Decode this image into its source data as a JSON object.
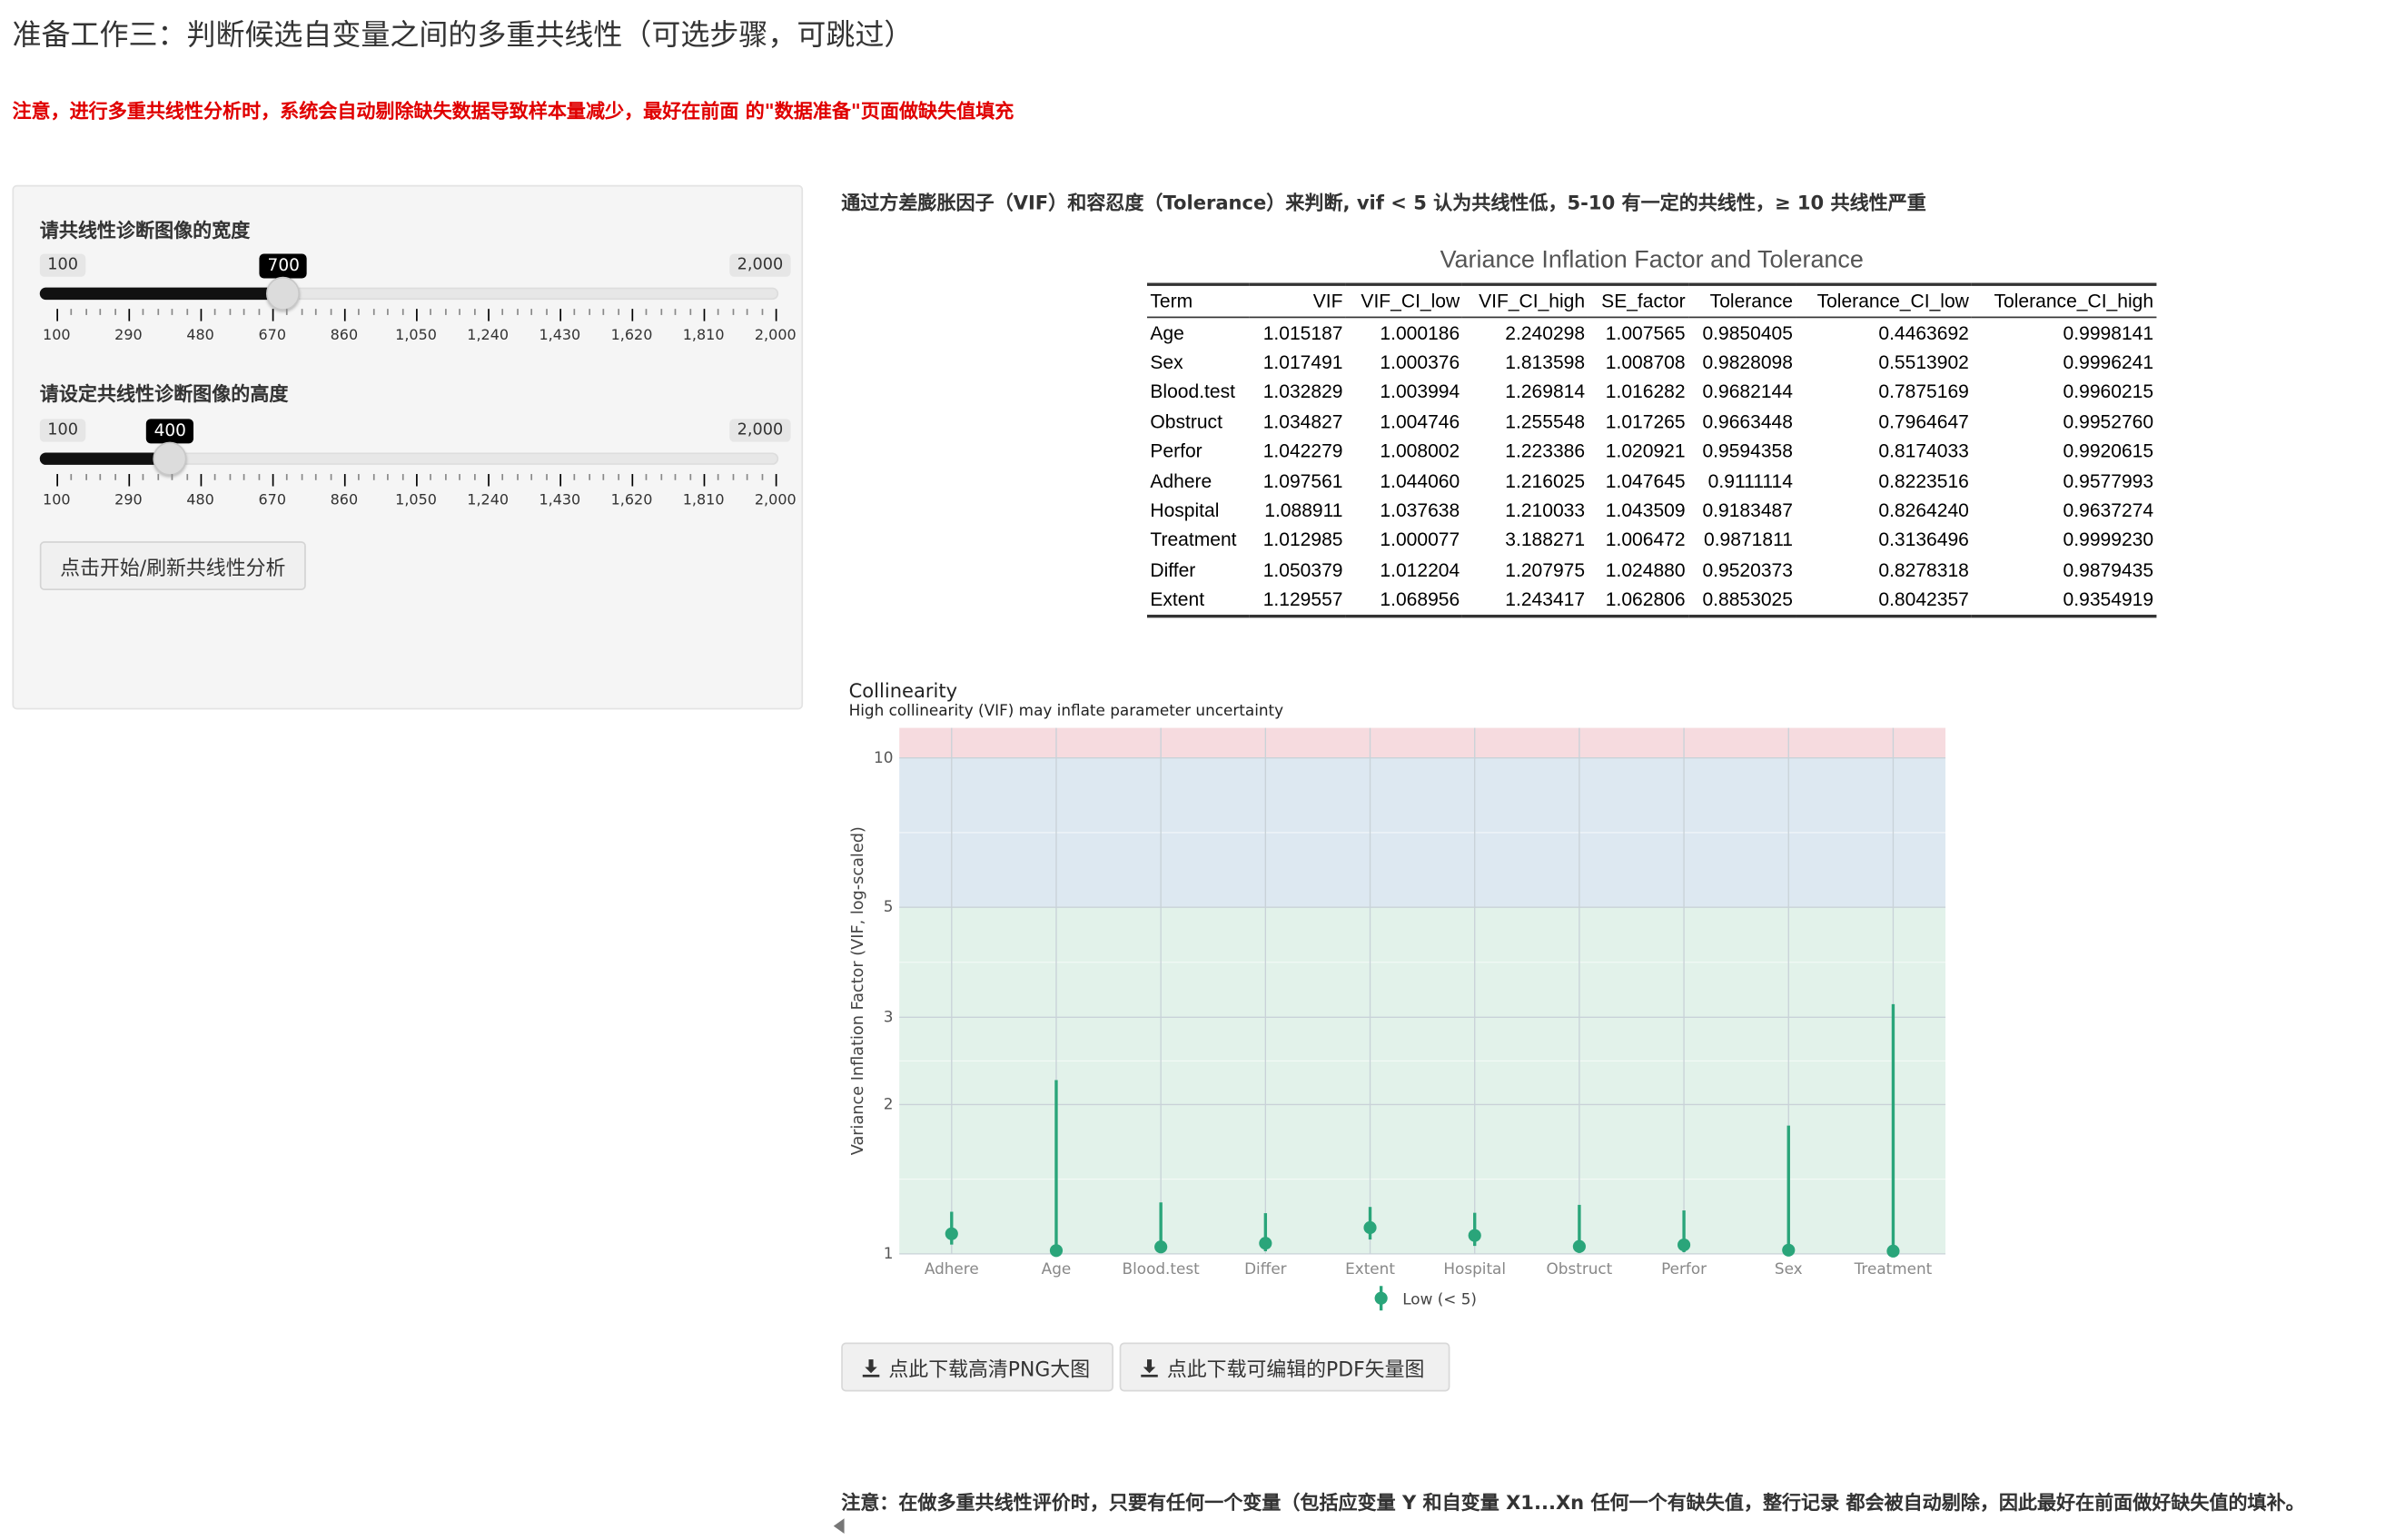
{
  "page": {
    "title": "准备工作三：判断候选自变量之间的多重共线性（可选步骤，可跳过）",
    "warning": "注意，进行多重共线性分析时，系统会自动剔除缺失数据导致样本量减少，最好在前面 的\"数据准备\"页面做缺失值填充"
  },
  "sidebar": {
    "width_slider": {
      "label": "请共线性诊断图像的宽度",
      "min_label": "100",
      "max_label": "2,000",
      "value_label": "700",
      "value": 700,
      "min": 100,
      "max": 2000,
      "tick_labels": [
        "100",
        "290",
        "480",
        "670",
        "860",
        "1,050",
        "1,240",
        "1,430",
        "1,620",
        "1,810",
        "2,000"
      ]
    },
    "height_slider": {
      "label": "请设定共线性诊断图像的高度",
      "min_label": "100",
      "max_label": "2,000",
      "value_label": "400",
      "value": 400,
      "min": 100,
      "max": 2000,
      "tick_labels": [
        "100",
        "290",
        "480",
        "670",
        "860",
        "1,050",
        "1,240",
        "1,430",
        "1,620",
        "1,810",
        "2,000"
      ]
    },
    "run_button": "点击开始/刷新共线性分析"
  },
  "main": {
    "description": "通过方差膨胀因子（VIF）和容忍度（Tolerance）来判断, vif < 5 认为共线性低，5-10 有一定的共线性，≥ 10 共线性严重",
    "table": {
      "title": "Variance Inflation Factor and Tolerance",
      "columns": [
        "Term",
        "VIF",
        "VIF_CI_low",
        "VIF_CI_high",
        "SE_factor",
        "Tolerance",
        "Tolerance_CI_low",
        "Tolerance_CI_high"
      ],
      "rows": [
        [
          "Age",
          "1.015187",
          "1.000186",
          "2.240298",
          "1.007565",
          "0.9850405",
          "0.4463692",
          "0.9998141"
        ],
        [
          "Sex",
          "1.017491",
          "1.000376",
          "1.813598",
          "1.008708",
          "0.9828098",
          "0.5513902",
          "0.9996241"
        ],
        [
          "Blood.test",
          "1.032829",
          "1.003994",
          "1.269814",
          "1.016282",
          "0.9682144",
          "0.7875169",
          "0.9960215"
        ],
        [
          "Obstruct",
          "1.034827",
          "1.004746",
          "1.255548",
          "1.017265",
          "0.9663448",
          "0.7964647",
          "0.9952760"
        ],
        [
          "Perfor",
          "1.042279",
          "1.008002",
          "1.223386",
          "1.020921",
          "0.9594358",
          "0.8174033",
          "0.9920615"
        ],
        [
          "Adhere",
          "1.097561",
          "1.044060",
          "1.216025",
          "1.047645",
          "0.9111114",
          "0.8223516",
          "0.9577993"
        ],
        [
          "Hospital",
          "1.088911",
          "1.037638",
          "1.210033",
          "1.043509",
          "0.9183487",
          "0.8264240",
          "0.9637274"
        ],
        [
          "Treatment",
          "1.012985",
          "1.000077",
          "3.188271",
          "1.006472",
          "0.9871811",
          "0.3136496",
          "0.9999230"
        ],
        [
          "Differ",
          "1.050379",
          "1.012204",
          "1.207975",
          "1.024880",
          "0.9520373",
          "0.8278318",
          "0.9879435"
        ],
        [
          "Extent",
          "1.129557",
          "1.068956",
          "1.243417",
          "1.062806",
          "0.8853025",
          "0.8042357",
          "0.9354919"
        ]
      ]
    },
    "download_png": "点此下载高清PNG大图",
    "download_pdf": "点此下载可编辑的PDF矢量图",
    "footer_note": "注意：在做多重共线性评价时，只要有任何一个变量（包括应变量 Y 和自变量 X1...Xn 任何一个有缺失值，整行记录 都会被自动剔除，因此最好在前面做好缺失值的填补。"
  },
  "chart_data": {
    "type": "scatter",
    "title": "Collinearity",
    "subtitle": "High collinearity (VIF) may inflate parameter uncertainty",
    "ylabel": "Variance Inflation Factor (VIF, log-scaled)",
    "xlabel": "",
    "y_scale": "log",
    "ylim": [
      1,
      11.5
    ],
    "y_ticks": [
      1,
      2,
      3,
      5,
      10
    ],
    "categories": [
      "Adhere",
      "Age",
      "Blood.test",
      "Differ",
      "Extent",
      "Hospital",
      "Obstruct",
      "Perfor",
      "Sex",
      "Treatment"
    ],
    "vif": [
      1.097561,
      1.015187,
      1.032829,
      1.050379,
      1.129557,
      1.088911,
      1.034827,
      1.042279,
      1.017491,
      1.012985
    ],
    "ci_low": [
      1.04406,
      1.000186,
      1.003994,
      1.012204,
      1.068956,
      1.037638,
      1.004746,
      1.008002,
      1.000376,
      1.000077
    ],
    "ci_high": [
      1.216025,
      2.240298,
      1.269814,
      1.207975,
      1.243417,
      1.210033,
      1.255548,
      1.223386,
      1.813598,
      3.188271
    ],
    "bands": [
      {
        "from": 1,
        "to": 5,
        "color": "#e2f2ea"
      },
      {
        "from": 5,
        "to": 10,
        "color": "#dde8f1"
      },
      {
        "from": 10,
        "to": 11.5,
        "color": "#f6dbdf"
      }
    ],
    "point_color": "#2aa57a",
    "legend": {
      "entries": [
        "Low (< 5)"
      ],
      "position": "bottom"
    },
    "grid": true
  }
}
